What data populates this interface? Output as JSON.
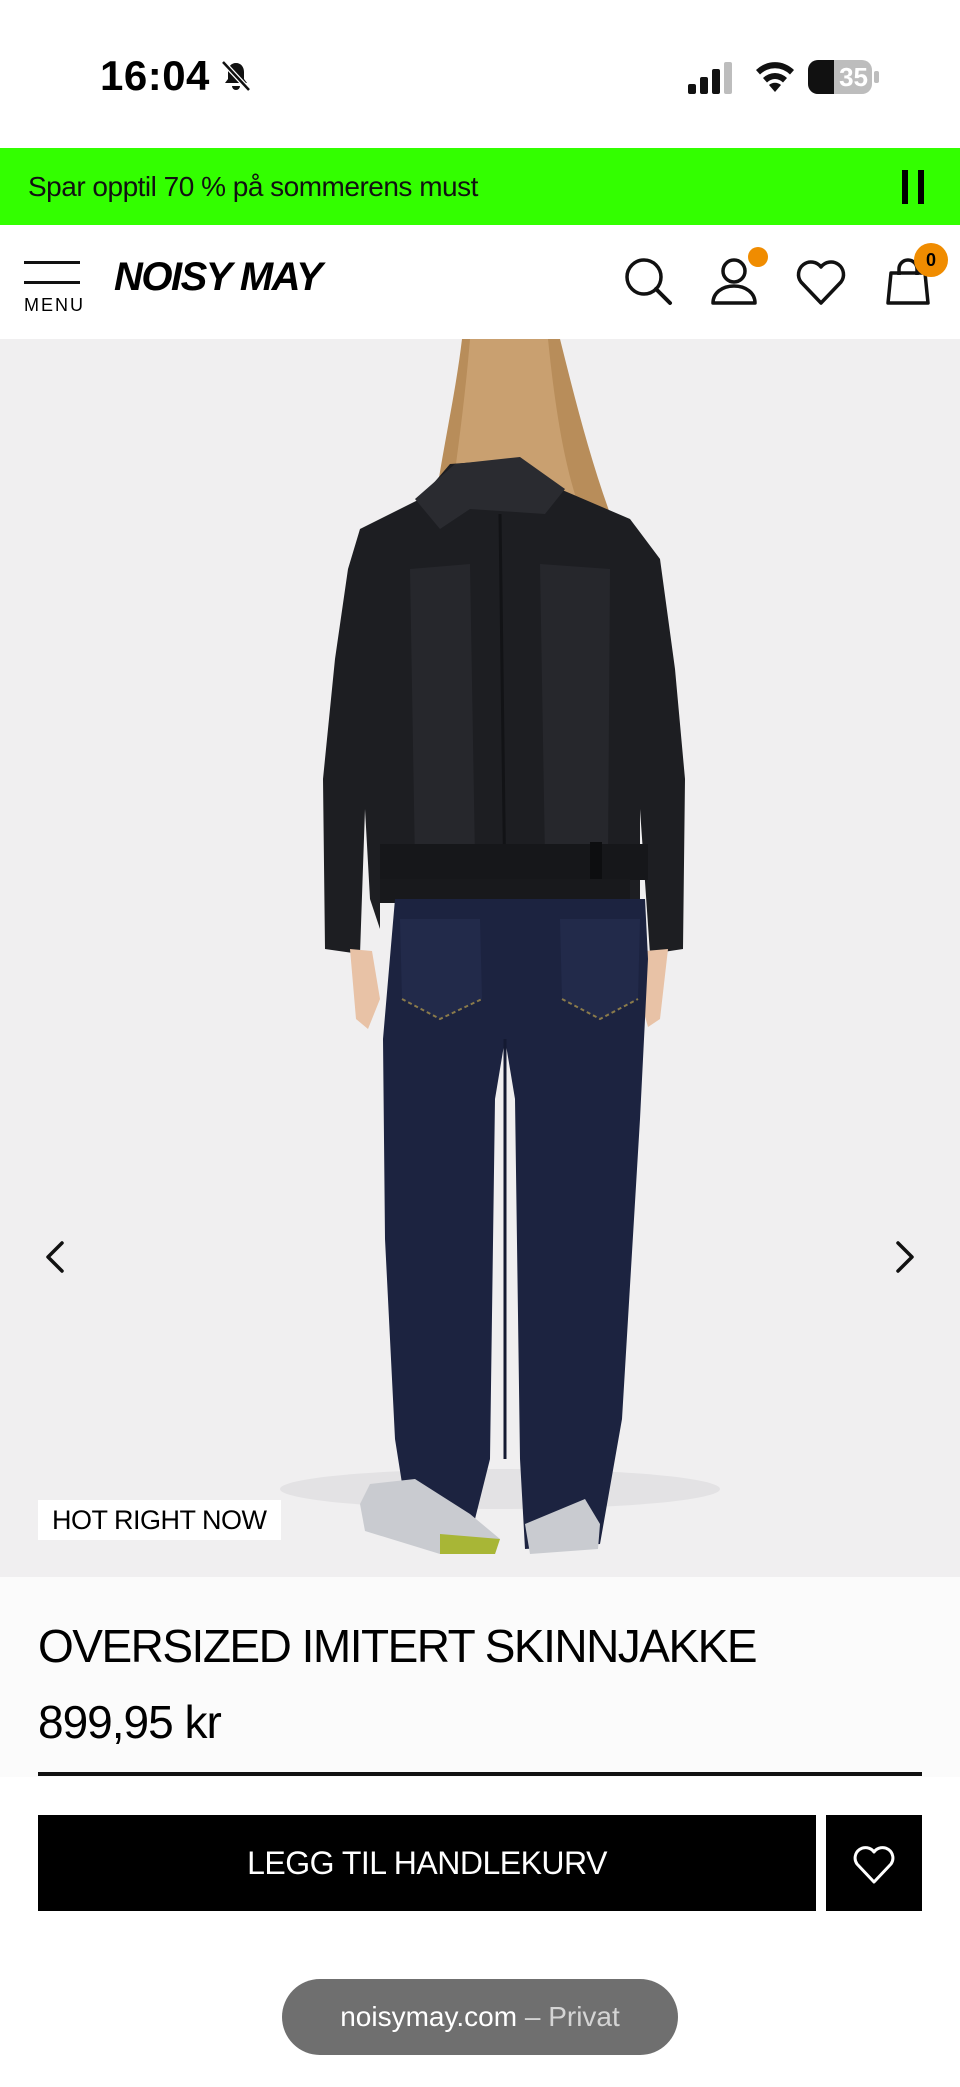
{
  "status_bar": {
    "time": "16:04",
    "battery": "35",
    "icons": [
      "bell-slash-icon",
      "signal-icon",
      "wifi-icon",
      "battery-icon"
    ]
  },
  "promo": {
    "text": "Spar opptil 70 % på sommerens must",
    "control_icon": "pause-icon",
    "background_color": "#33ff00"
  },
  "header": {
    "menu_label": "MENU",
    "logo": "NOISY MAY",
    "icons": [
      "search-icon",
      "account-icon",
      "heart-icon",
      "bag-icon"
    ],
    "cart_count": "0",
    "badge_color": "#f08c00"
  },
  "gallery": {
    "tag": "HOT RIGHT NOW",
    "prev_icon": "chevron-left-icon",
    "next_icon": "chevron-right-icon"
  },
  "product": {
    "title": "OVERSIZED IMITERT SKINNJAKKE",
    "price": "899,95 kr"
  },
  "cta": {
    "add_to_cart": "LEGG TIL HANDLEKURV",
    "wishlist_icon": "heart-icon"
  },
  "browser": {
    "domain": "noisymay.com",
    "mode": "– Privat"
  }
}
